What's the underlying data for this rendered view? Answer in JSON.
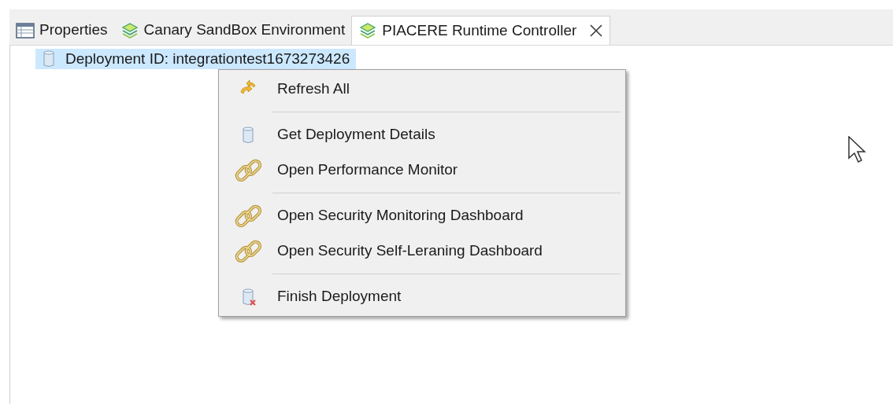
{
  "tabs": [
    {
      "label": "Properties",
      "selected": false
    },
    {
      "label": "Canary SandBox Environment",
      "selected": false
    },
    {
      "label": "PIACERE Runtime Controller",
      "selected": true
    }
  ],
  "tree": {
    "items": [
      {
        "label": "Deployment ID: integrationtest1673273426",
        "selected": true
      }
    ]
  },
  "context_menu": {
    "items": [
      {
        "kind": "item",
        "label": "Refresh All"
      },
      {
        "kind": "separator"
      },
      {
        "kind": "item",
        "label": "Get Deployment Details"
      },
      {
        "kind": "item",
        "label": "Open Performance Monitor"
      },
      {
        "kind": "separator"
      },
      {
        "kind": "item",
        "label": "Open Security Monitoring Dashboard"
      },
      {
        "kind": "item",
        "label": "Open Security Self-Leraning Dashboard"
      },
      {
        "kind": "separator"
      },
      {
        "kind": "item",
        "label": "Finish Deployment"
      }
    ]
  }
}
